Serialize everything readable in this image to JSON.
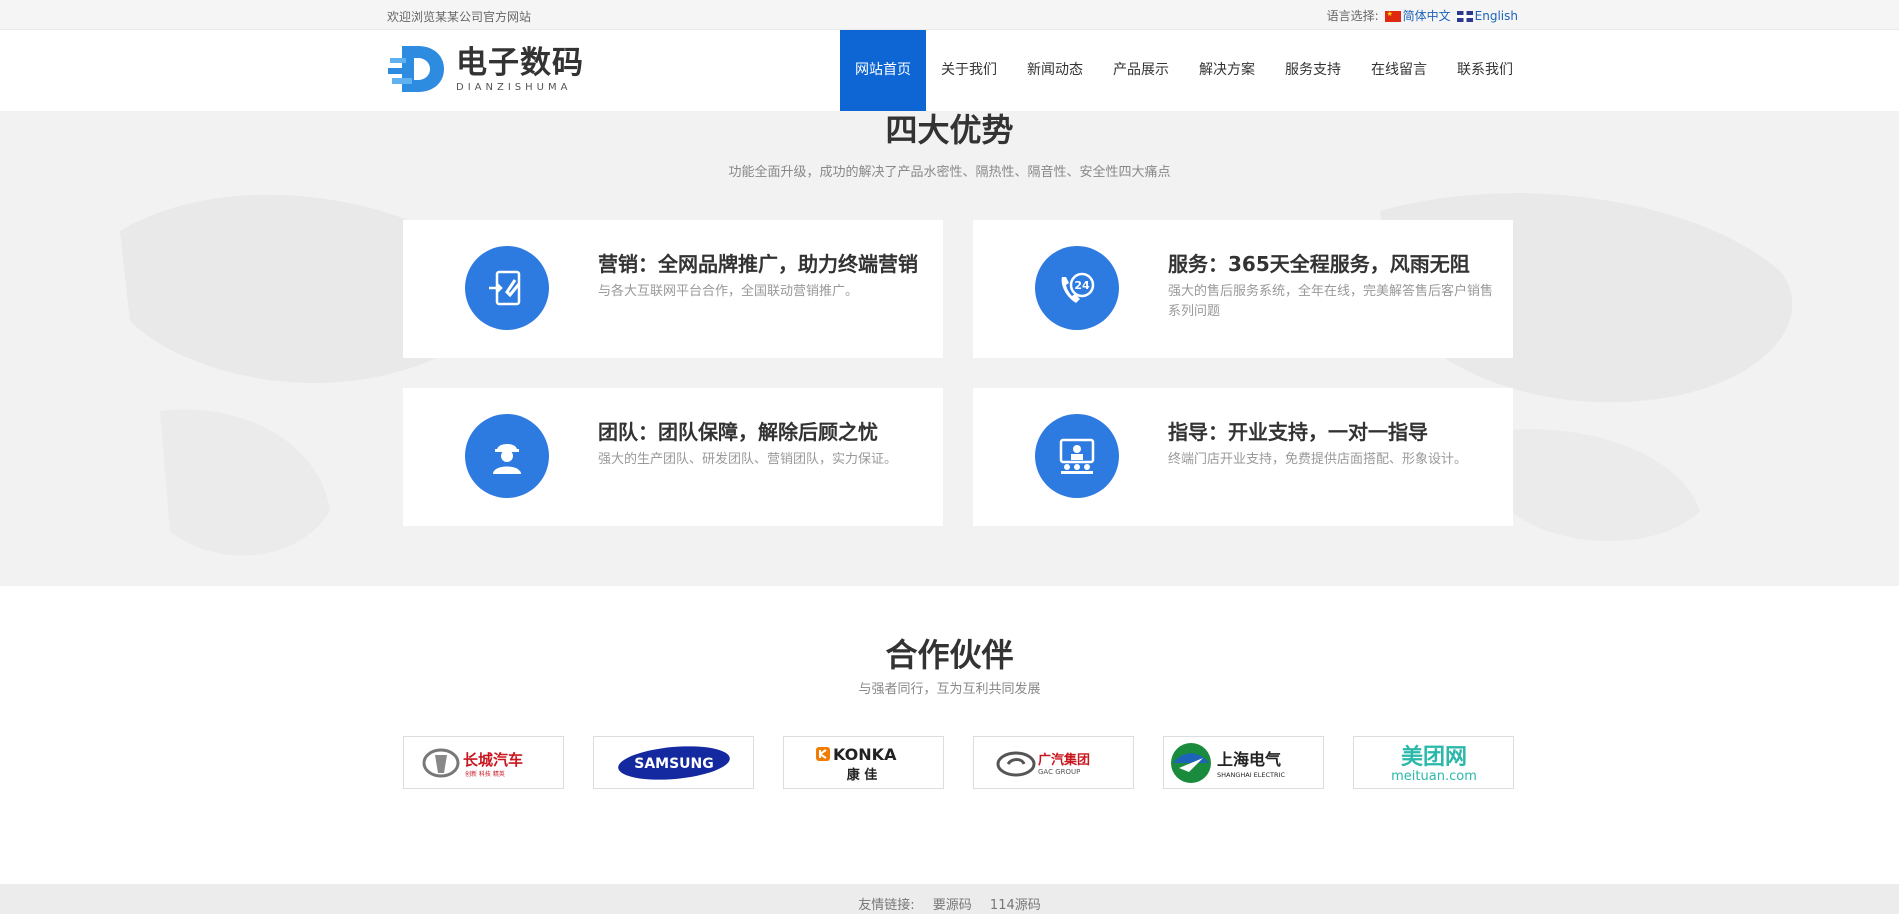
{
  "topbar": {
    "welcome": "欢迎浏览某某公司官方网站",
    "lang_label": "语言选择:",
    "lang_cn": "简体中文",
    "lang_en": "English"
  },
  "logo": {
    "cn": "电子数码",
    "en": "DIANZISHUMA",
    "brand_color": "#2d8be0"
  },
  "nav": {
    "items": [
      "网站首页",
      "关于我们",
      "新闻动态",
      "产品展示",
      "解决方案",
      "服务支持",
      "在线留言",
      "联系我们"
    ],
    "active_index": 0,
    "active_color": "#0e66d4"
  },
  "advantages": {
    "title": "四大优势",
    "subtitle": "功能全面升级，成功的解决了产品水密性、隔热性、隔音性、安全性四大痛点",
    "cards": [
      {
        "icon": "wrench-door-icon",
        "title": "营销：全网品牌推广，助力终端营销",
        "desc": "与各大互联网平台合作，全国联动营销推广。"
      },
      {
        "icon": "phone-24-icon",
        "title": "服务：365天全程服务，风雨无阻",
        "desc": "强大的售后服务系统，全年在线，完美解答售后客户销售系列问题"
      },
      {
        "icon": "worker-icon",
        "title": "团队：团队保障，解除后顾之忧",
        "desc": "强大的生产团队、研发团队、营销团队，实力保证。"
      },
      {
        "icon": "presentation-icon",
        "title": "指导：开业支持，一对一指导",
        "desc": "终端门店开业支持，免费提供店面搭配、形象设计。"
      }
    ],
    "icon_color": "#2d7be0"
  },
  "partners": {
    "title": "合作伙伴",
    "subtitle": "与强者同行，互为互利共同发展",
    "logos": [
      {
        "name": "great-wall-logo",
        "text": "长城汽车",
        "small": "创新 科技 精英"
      },
      {
        "name": "samsung-logo",
        "text": "SAMSUNG"
      },
      {
        "name": "konka-logo",
        "text": "KONKA",
        "small": "康 佳"
      },
      {
        "name": "gac-logo",
        "text": "广汽集团",
        "small": "GAC GROUP"
      },
      {
        "name": "shanghai-electric-logo",
        "text": "上海电气",
        "small": "SHANGHAI ELECTRIC"
      },
      {
        "name": "meituan-logo",
        "text": "美团网",
        "small": "meituan.com"
      }
    ]
  },
  "footer": {
    "label": "友情链接:",
    "links": [
      "要源码",
      "114源码"
    ]
  }
}
